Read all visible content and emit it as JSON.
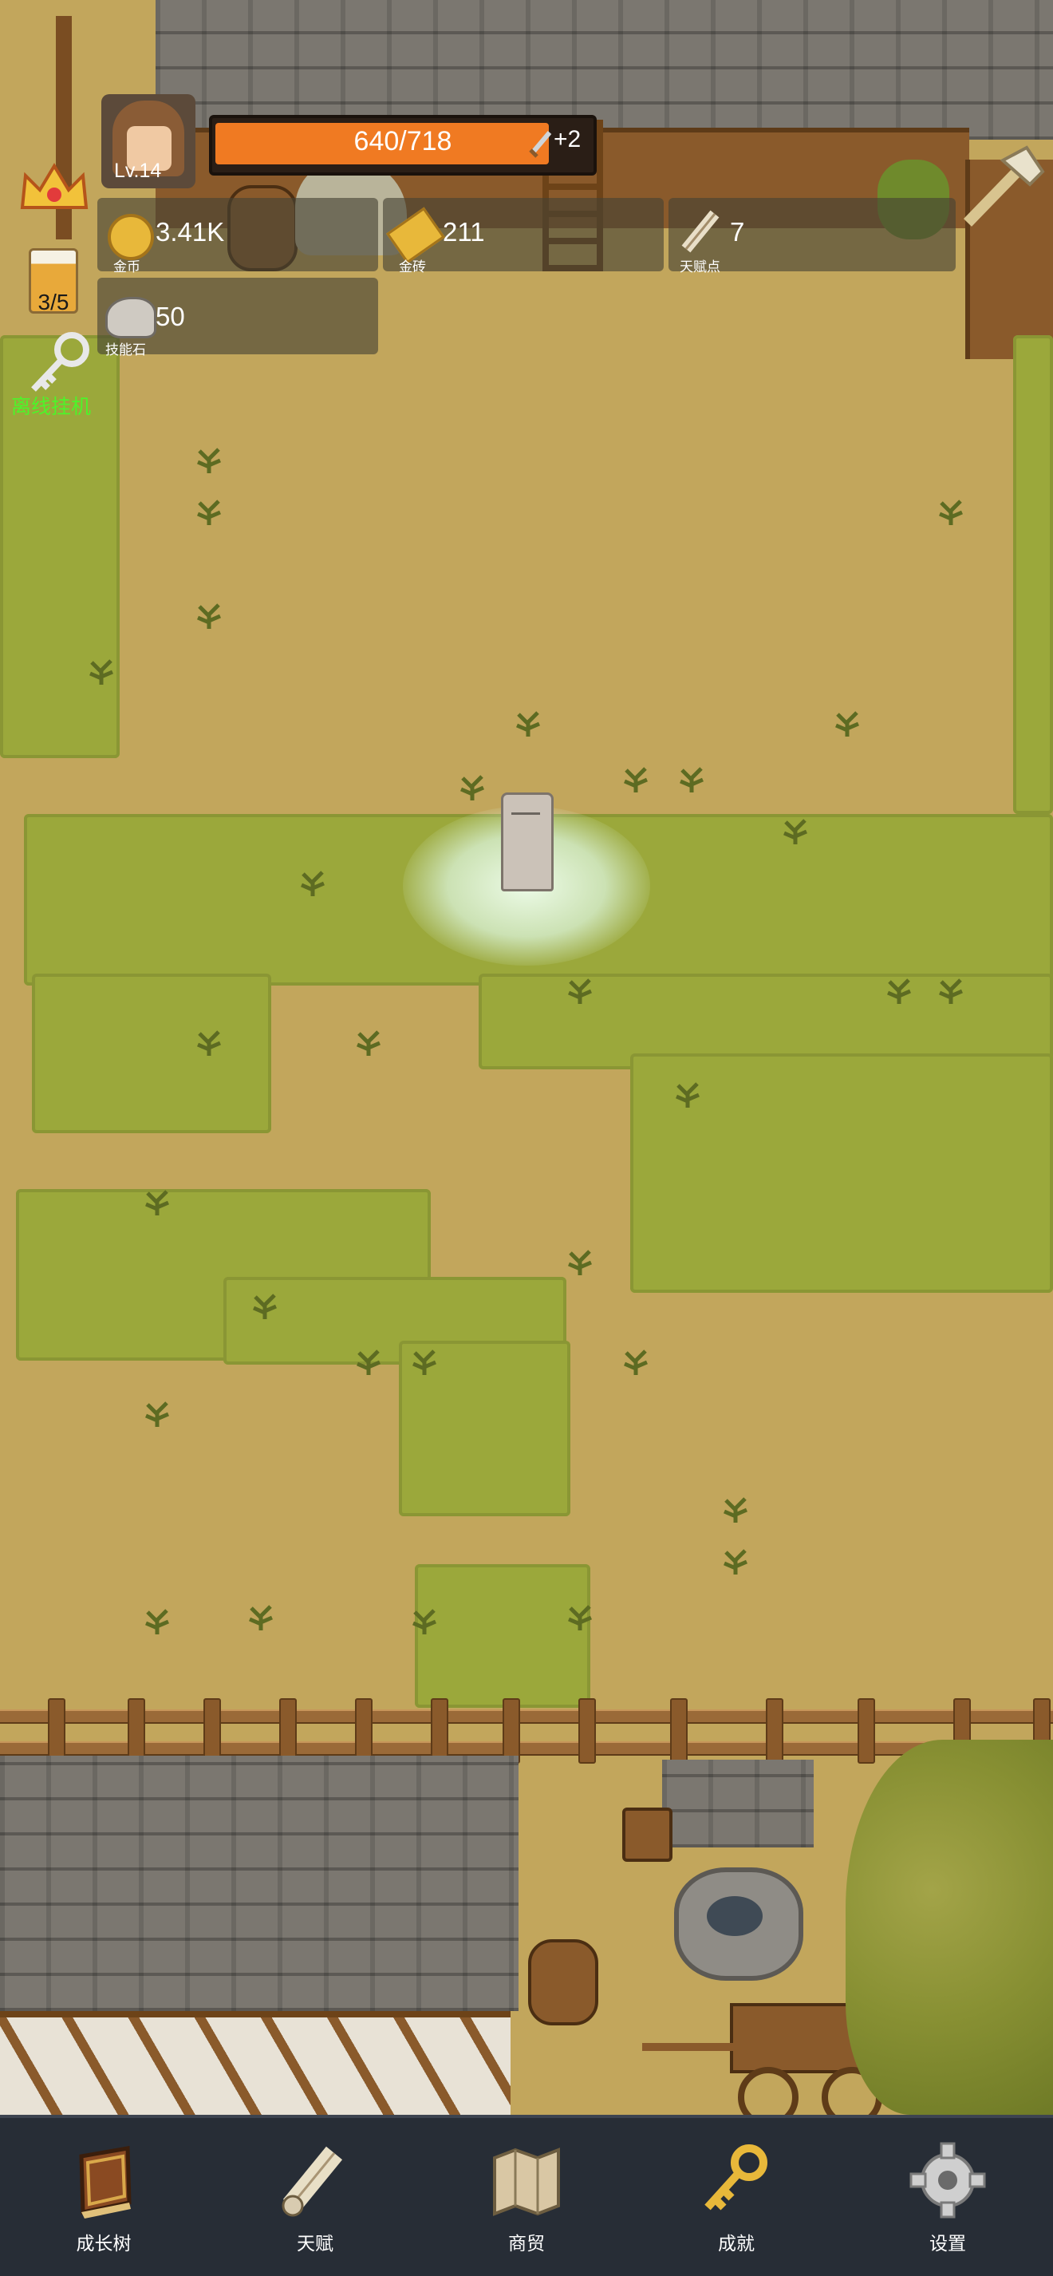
{
  "player": {
    "level": "Lv.14"
  },
  "hp_bar": {
    "current_max": "640/718",
    "fill_fraction": 0.89,
    "bonus": "+2"
  },
  "resources": [
    {
      "value": "3.41K",
      "caption": "金币",
      "icon": "gold-coin-icon"
    },
    {
      "value": "211",
      "caption": "金砖",
      "icon": "gold-bar-icon"
    },
    {
      "value": "7",
      "caption": "天赋点",
      "icon": "talent-scroll-icon"
    },
    {
      "value": "50",
      "caption": "技能石",
      "icon": "skill-stone-icon"
    }
  ],
  "side": {
    "beer_count": "3/5",
    "idle_label": "离线挂机"
  },
  "nav": [
    {
      "label": "成长树",
      "icon": "book-icon"
    },
    {
      "label": "天赋",
      "icon": "scroll-icon"
    },
    {
      "label": "商贸",
      "icon": "map-icon"
    },
    {
      "label": "成就",
      "icon": "key-icon"
    },
    {
      "label": "设置",
      "icon": "gear-icon"
    }
  ],
  "colors": {
    "hp_fill": "#f07a22",
    "grass": "#9ba83b",
    "dirt": "#c2a65c",
    "navbar": "#272d36",
    "idle_text": "#4cf52a"
  }
}
